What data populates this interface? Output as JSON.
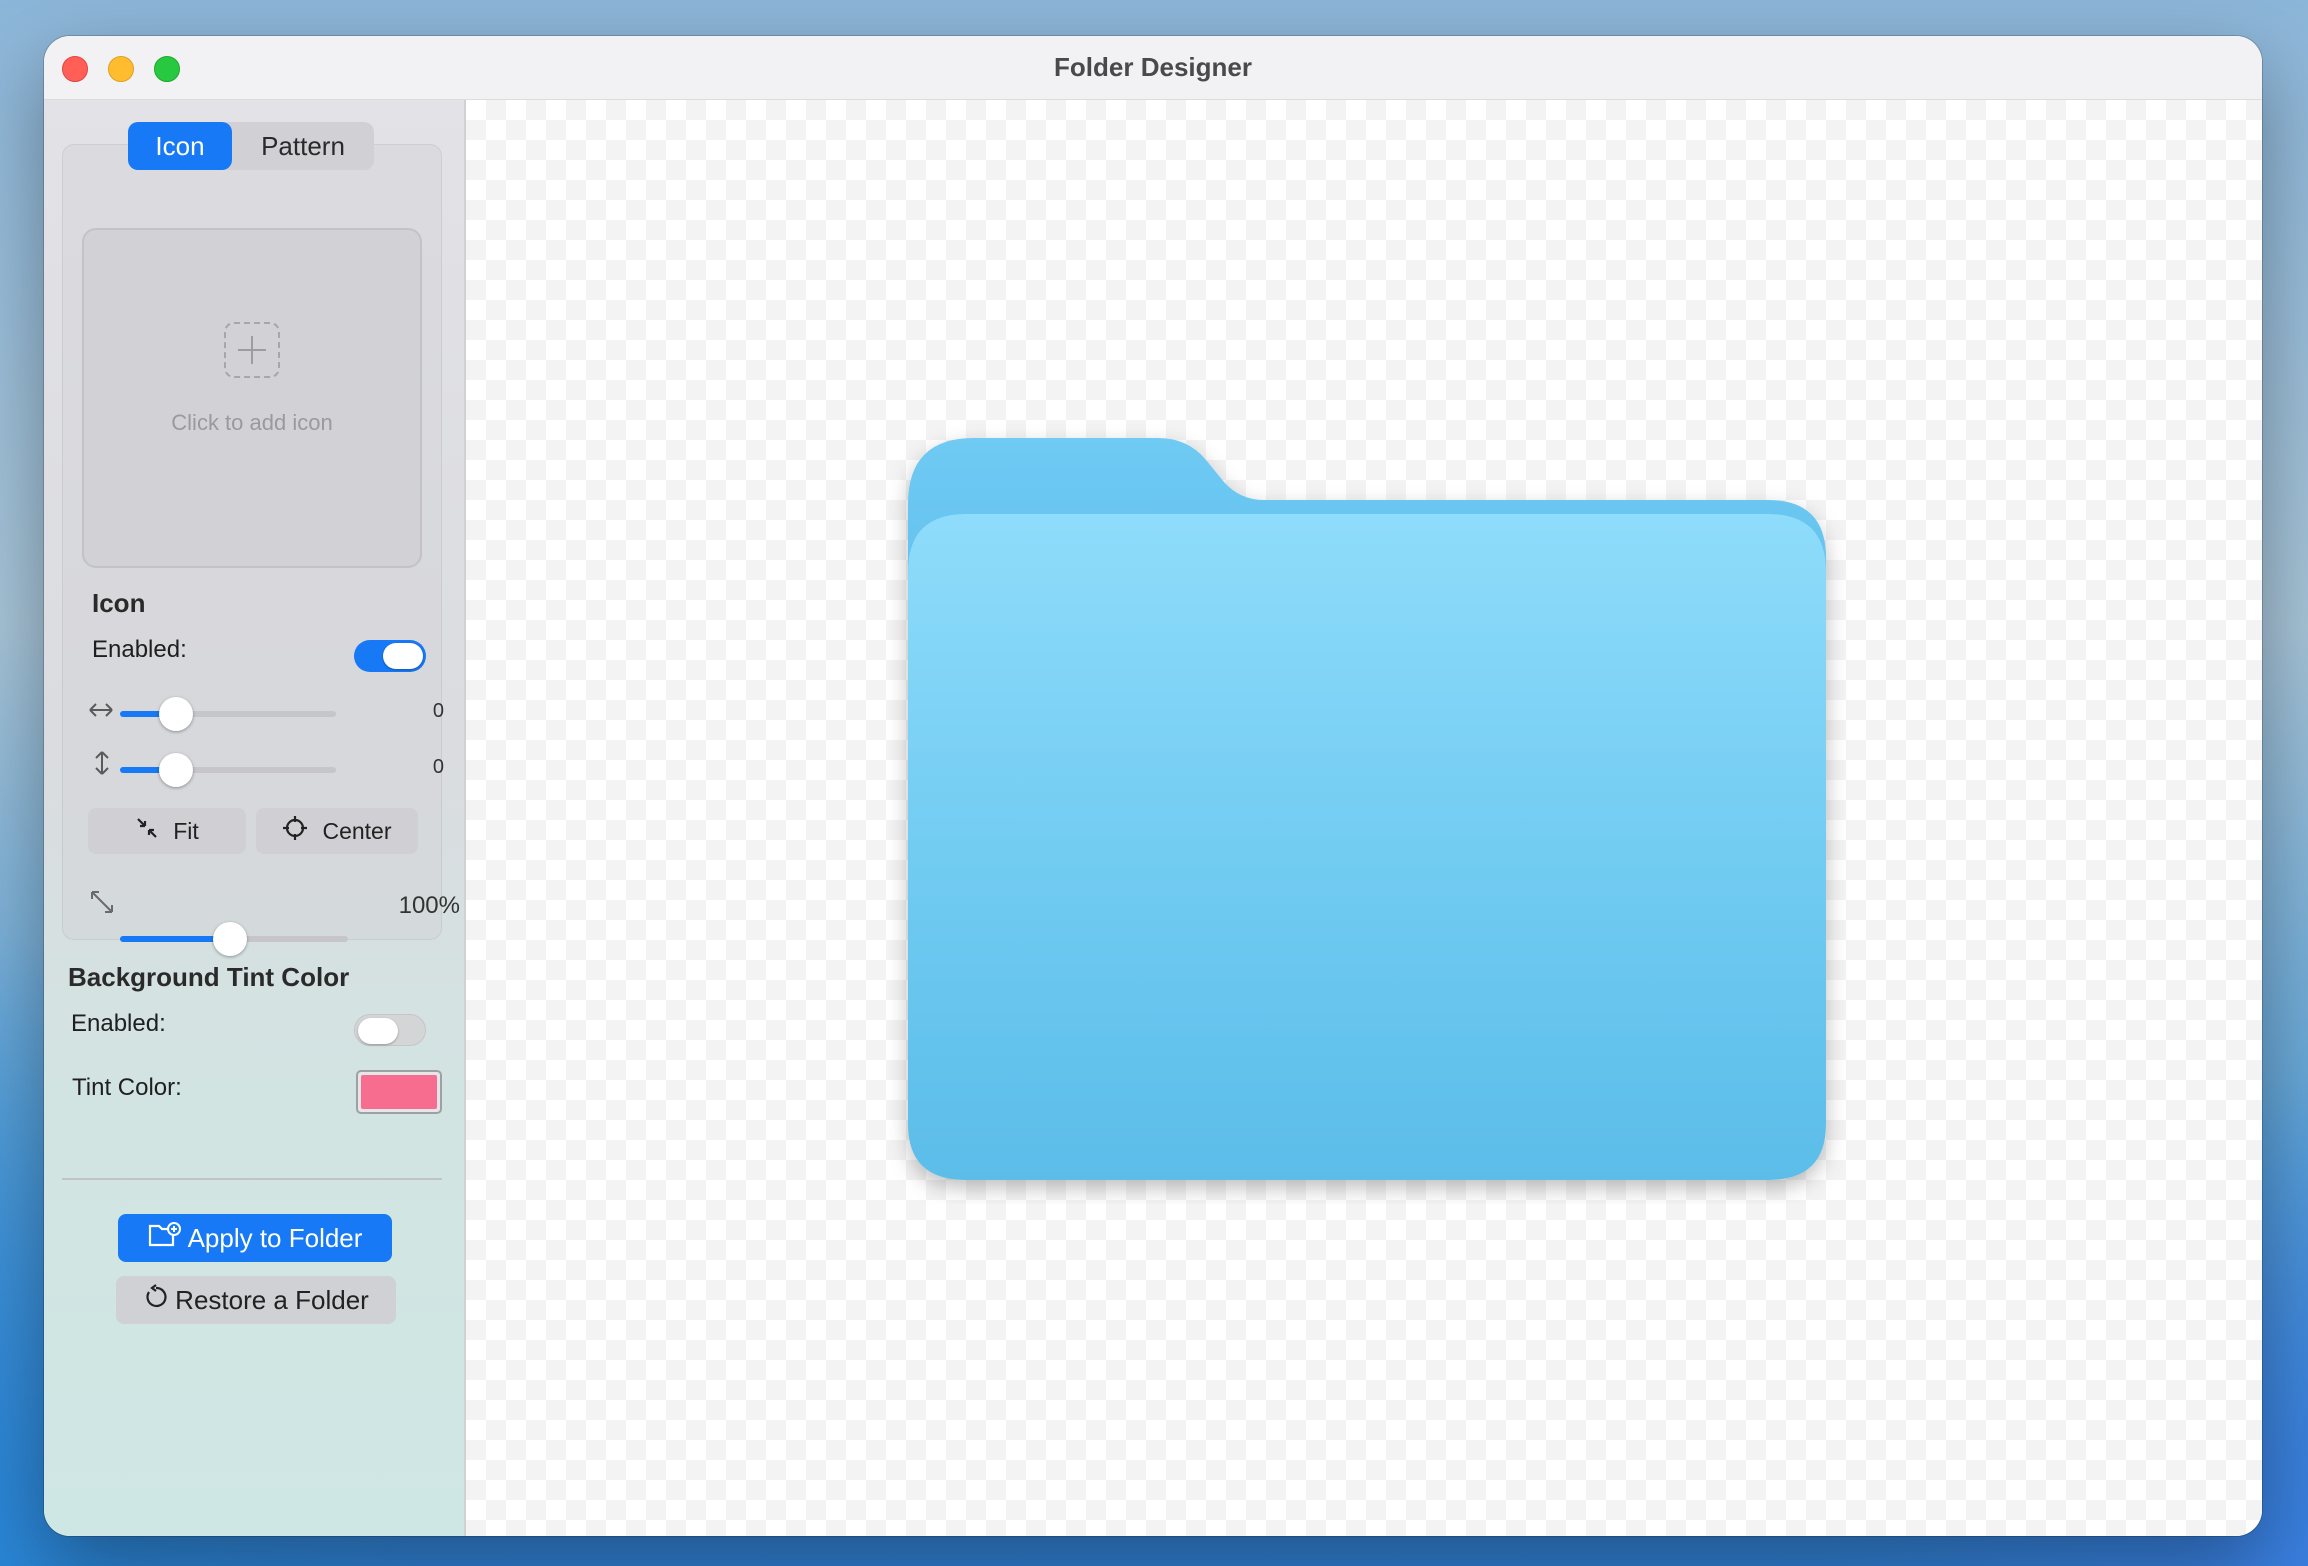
{
  "window": {
    "title": "Folder Designer"
  },
  "tabs": {
    "active": "Icon",
    "inactive": "Pattern"
  },
  "dropzone": {
    "text": "Click to add icon",
    "icon": "plus-icon"
  },
  "icon_section": {
    "heading": "Icon",
    "enabled_label": "Enabled:",
    "enabled": true,
    "x_offset": {
      "value": 0,
      "display": "0",
      "icon": "horizontal-arrows-icon"
    },
    "y_offset": {
      "value": 0,
      "display": "0",
      "icon": "vertical-arrows-icon"
    },
    "fit_label": "Fit",
    "center_label": "Center",
    "scale": {
      "value": 100,
      "display": "100%",
      "icon": "resize-icon"
    }
  },
  "tint_section": {
    "heading": "Background Tint Color",
    "enabled_label": "Enabled:",
    "enabled": false,
    "tint_label": "Tint Color:",
    "tint_color": "#f66d90"
  },
  "actions": {
    "apply_label": "Apply to Folder",
    "restore_label": "Restore a Folder"
  },
  "colors": {
    "accent": "#1779f5",
    "folder_front": "#72ccf2",
    "folder_back": "#5bbde9"
  }
}
